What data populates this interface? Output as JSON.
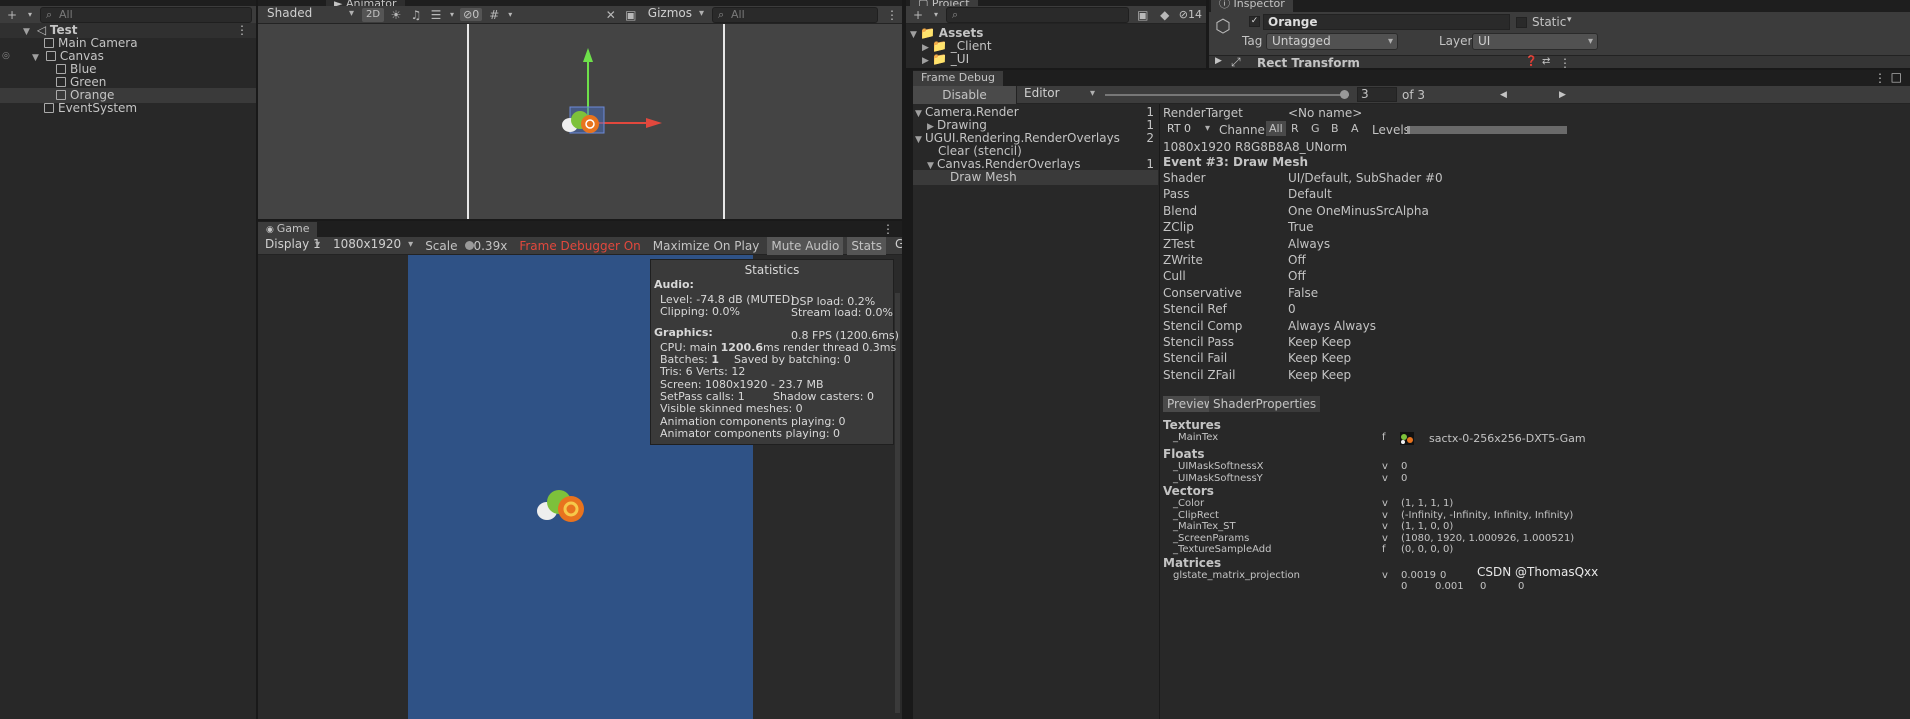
{
  "hierarchy": {
    "search_placeholder": "All",
    "scene_name": "Test",
    "items": [
      {
        "label": "Main Camera"
      },
      {
        "label": "Canvas"
      },
      {
        "label": "Blue"
      },
      {
        "label": "Green"
      },
      {
        "label": "Orange"
      },
      {
        "label": "EventSystem"
      }
    ]
  },
  "scene_view": {
    "tab_animator": "Animator",
    "shading": "Shaded",
    "mode_2d": "2D",
    "hidden_count": "0",
    "gizmos": "Gizmos",
    "search_placeholder": "All"
  },
  "game_view": {
    "tab": "Game",
    "display": "Display 1",
    "resolution": "1080x1920",
    "scale_label": "Scale",
    "scale_value": "0.39x",
    "frame_debugger": "Frame Debugger On",
    "maximize": "Maximize On Play",
    "mute": "Mute Audio",
    "stats": "Stats",
    "gizmos": "Gizmos"
  },
  "statistics": {
    "title": "Statistics",
    "audio_header": "Audio:",
    "level": "Level: -74.8 dB (MUTED)",
    "dsp": "DSP load: 0.2%",
    "clipping": "Clipping: 0.0%",
    "stream": "Stream load: 0.0%",
    "graphics_header": "Graphics:",
    "fps": "0.8 FPS (1200.6ms)",
    "cpu_prefix": "CPU: main ",
    "cpu_main": "1200.6",
    "cpu_suffix": "ms  render thread 0.3ms",
    "batches_prefix": "Batches: ",
    "batches": "1",
    "saved": "Saved by batching: 0",
    "tris": "Tris: 6   Verts: 12",
    "screen": "Screen: 1080x1920 - 23.7 MB",
    "setpass": "SetPass calls: 1",
    "shadow": "Shadow casters: 0",
    "skinned": "Visible skinned meshes: 0",
    "anim": "Animation components playing: 0",
    "animator": "Animator components playing: 0"
  },
  "project": {
    "tab": "Project",
    "hidden_count": "14",
    "assets": "Assets",
    "folders": [
      "_Client",
      "_UI"
    ]
  },
  "inspector": {
    "tab": "Inspector",
    "object_name": "Orange",
    "static": "Static",
    "tag_label": "Tag",
    "tag": "Untagged",
    "layer_label": "Layer",
    "layer": "UI",
    "component": "Rect Transform"
  },
  "frame_debug": {
    "tab": "Frame Debug",
    "disable": "Disable",
    "target": "Editor",
    "event_index": "3",
    "of_total": "of 3",
    "tree": [
      {
        "label": "Camera.Render",
        "count": "1"
      },
      {
        "label": "Drawing",
        "count": "1"
      },
      {
        "label": "UGUI.Rendering.RenderOverlays",
        "count": "2"
      },
      {
        "label": "Clear (stencil)",
        "count": ""
      },
      {
        "label": "Canvas.RenderOverlays",
        "count": "1"
      },
      {
        "label": "Draw Mesh",
        "count": ""
      }
    ],
    "render_target_label": "RenderTarget",
    "render_target": "<No name>",
    "rt": "RT 0",
    "channels_label": "Channels",
    "channels": [
      "All",
      "R",
      "G",
      "B",
      "A"
    ],
    "levels_label": "Levels",
    "format": "1080x1920 R8G8B8A8_UNorm",
    "event_title": "Event #3: Draw Mesh",
    "props": [
      {
        "name": "Shader",
        "value": "UI/Default, SubShader #0"
      },
      {
        "name": "Pass",
        "value": "Default"
      },
      {
        "name": "Blend",
        "value": "One OneMinusSrcAlpha"
      },
      {
        "name": "ZClip",
        "value": "True"
      },
      {
        "name": "ZTest",
        "value": "Always"
      },
      {
        "name": "ZWrite",
        "value": "Off"
      },
      {
        "name": "Cull",
        "value": "Off"
      },
      {
        "name": "Conservative",
        "value": "False"
      },
      {
        "name": "Stencil Ref",
        "value": "0"
      },
      {
        "name": "Stencil Comp",
        "value": "Always Always"
      },
      {
        "name": "Stencil Pass",
        "value": "Keep Keep"
      },
      {
        "name": "Stencil Fail",
        "value": "Keep Keep"
      },
      {
        "name": "Stencil ZFail",
        "value": "Keep Keep"
      }
    ],
    "tab_preview": "Preview",
    "tab_shader_props": "ShaderProperties",
    "textures_header": "Textures",
    "texture": {
      "name": "_MainTex",
      "type": "f",
      "value": "sactx-0-256x256-DXT5-Gam"
    },
    "floats_header": "Floats",
    "floats": [
      {
        "name": "_UIMaskSoftnessX",
        "type": "v",
        "value": "0"
      },
      {
        "name": "_UIMaskSoftnessY",
        "type": "v",
        "value": "0"
      }
    ],
    "vectors_header": "Vectors",
    "vectors": [
      {
        "name": "_Color",
        "type": "v",
        "value": "(1, 1, 1, 1)"
      },
      {
        "name": "_ClipRect",
        "type": "v",
        "value": "(-Infinity, -Infinity, Infinity, Infinity)"
      },
      {
        "name": "_MainTex_ST",
        "type": "v",
        "value": "(1, 1, 0, 0)"
      },
      {
        "name": "_ScreenParams",
        "type": "v",
        "value": "(1080, 1920, 1.000926, 1.000521)"
      },
      {
        "name": "_TextureSampleAdd",
        "type": "f",
        "value": "(0, 0, 0, 0)"
      }
    ],
    "matrices_header": "Matrices",
    "matrix": {
      "name": "glstate_matrix_projection",
      "type": "v",
      "row1": [
        "0.0019",
        "0"
      ],
      "row2": [
        "0",
        "0.001",
        "0",
        "0"
      ]
    }
  },
  "watermark": "CSDN @ThomasQxx",
  "colors": {
    "game_bg": "#2f5286",
    "accent_red": "#e2483d",
    "axis_green": "#6ee04a"
  }
}
